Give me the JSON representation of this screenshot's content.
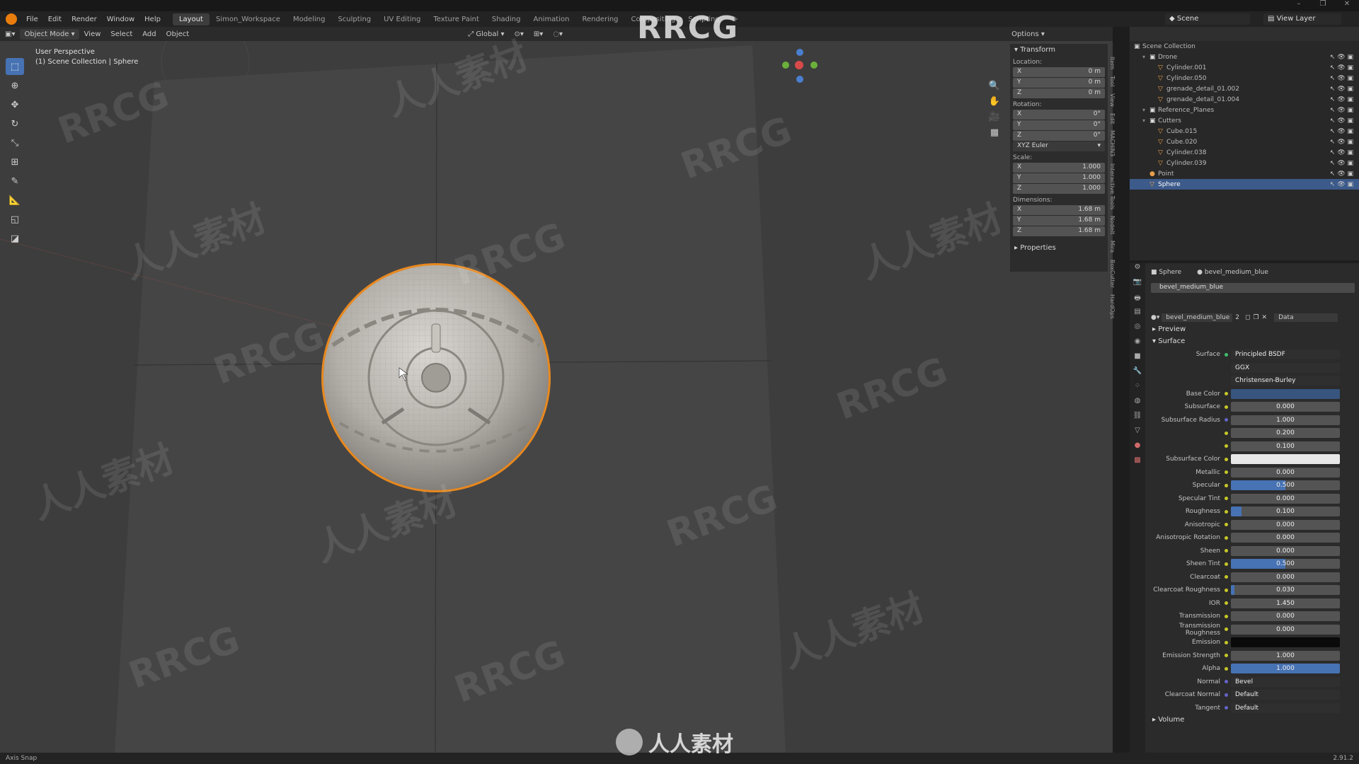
{
  "menu": [
    "File",
    "Edit",
    "Render",
    "Window",
    "Help"
  ],
  "workspaces": [
    "Layout",
    "Simon_Workspace",
    "Modeling",
    "Sculpting",
    "UV Editing",
    "Texture Paint",
    "Shading",
    "Animation",
    "Rendering",
    "Compositing",
    "Scripting",
    "+"
  ],
  "watermark_title": "RRCG",
  "watermark_cn": "人人素材",
  "scene": "Scene",
  "view_layer": "View Layer",
  "viewport_header": {
    "mode": "Object Mode",
    "items": [
      "View",
      "Select",
      "Add",
      "Object"
    ],
    "orientation": "Global",
    "options": "Options"
  },
  "viewport_info": {
    "line1": "User Perspective",
    "line2": "(1) Scene Collection | Sphere"
  },
  "npanel": {
    "transform": "Transform",
    "location_label": "Location:",
    "location": [
      {
        "a": "X",
        "v": "0 m"
      },
      {
        "a": "Y",
        "v": "0 m"
      },
      {
        "a": "Z",
        "v": "0 m"
      }
    ],
    "rotation_label": "Rotation:",
    "rotation": [
      {
        "a": "X",
        "v": "0°"
      },
      {
        "a": "Y",
        "v": "0°"
      },
      {
        "a": "Z",
        "v": "0°"
      }
    ],
    "rotation_mode": "XYZ Euler",
    "scale_label": "Scale:",
    "scale": [
      {
        "a": "X",
        "v": "1.000"
      },
      {
        "a": "Y",
        "v": "1.000"
      },
      {
        "a": "Z",
        "v": "1.000"
      }
    ],
    "dimensions_label": "Dimensions:",
    "dimensions": [
      {
        "a": "X",
        "v": "1.68 m"
      },
      {
        "a": "Y",
        "v": "1.68 m"
      },
      {
        "a": "Z",
        "v": "1.68 m"
      }
    ],
    "properties": "Properties",
    "tabs": [
      "Item",
      "Tool",
      "View",
      "Edit",
      "MACHIN3",
      "Interactive Tools",
      "NodeIt",
      "Mira",
      "BoxCutter",
      "HardOps"
    ]
  },
  "outliner": {
    "root": "Scene Collection",
    "rows": [
      {
        "name": "Drone",
        "level": 1,
        "kind": "collection"
      },
      {
        "name": "Cylinder.001",
        "level": 2,
        "kind": "mesh"
      },
      {
        "name": "Cylinder.050",
        "level": 2,
        "kind": "mesh"
      },
      {
        "name": "grenade_detail_01.002",
        "level": 2,
        "kind": "mesh"
      },
      {
        "name": "grenade_detail_01.004",
        "level": 2,
        "kind": "mesh"
      },
      {
        "name": "Reference_Planes",
        "level": 1,
        "kind": "collection"
      },
      {
        "name": "Cutters",
        "level": 1,
        "kind": "collection"
      },
      {
        "name": "Cube.015",
        "level": 2,
        "kind": "mesh"
      },
      {
        "name": "Cube.020",
        "level": 2,
        "kind": "mesh"
      },
      {
        "name": "Cylinder.038",
        "level": 2,
        "kind": "mesh"
      },
      {
        "name": "Cylinder.039",
        "level": 2,
        "kind": "mesh"
      },
      {
        "name": "Point",
        "level": 1,
        "kind": "light"
      },
      {
        "name": "Sphere",
        "level": 1,
        "kind": "mesh",
        "selected": true
      }
    ]
  },
  "properties": {
    "object": "Sphere",
    "material": "bevel_medium_blue",
    "slot": "bevel_medium_blue",
    "users": "2",
    "link": "Data",
    "preview": "Preview",
    "surface_section": "Surface",
    "surface": {
      "label": "Surface",
      "value": "Principled BSDF"
    },
    "distribution": "GGX",
    "subsurface_method": "Christensen-Burley",
    "rows": [
      {
        "label": "Base Color",
        "value": "",
        "type": "blue"
      },
      {
        "label": "Subsurface",
        "value": "0.000",
        "fill": 0
      },
      {
        "label": "Subsurface Radius",
        "value": "1.000",
        "type": "plainnum",
        "dot": "p"
      },
      {
        "label": "",
        "value": "0.200",
        "type": "plainnum"
      },
      {
        "label": "",
        "value": "0.100",
        "type": "plainnum"
      },
      {
        "label": "Subsurface Color",
        "value": "",
        "type": "white"
      },
      {
        "label": "Metallic",
        "value": "0.000",
        "fill": 0
      },
      {
        "label": "Specular",
        "value": "0.500",
        "fill": 0.5
      },
      {
        "label": "Specular Tint",
        "value": "0.000",
        "fill": 0
      },
      {
        "label": "Roughness",
        "value": "0.100",
        "fill": 0.1
      },
      {
        "label": "Anisotropic",
        "value": "0.000",
        "fill": 0
      },
      {
        "label": "Anisotropic Rotation",
        "value": "0.000",
        "fill": 0
      },
      {
        "label": "Sheen",
        "value": "0.000",
        "fill": 0
      },
      {
        "label": "Sheen Tint",
        "value": "0.500",
        "fill": 0.5
      },
      {
        "label": "Clearcoat",
        "value": "0.000",
        "fill": 0
      },
      {
        "label": "Clearcoat Roughness",
        "value": "0.030",
        "fill": 0.03
      },
      {
        "label": "IOR",
        "value": "1.450",
        "fill": 0
      },
      {
        "label": "Transmission",
        "value": "0.000",
        "fill": 0
      },
      {
        "label": "Transmission Roughness",
        "value": "0.000",
        "fill": 0
      },
      {
        "label": "Emission",
        "value": "",
        "type": "black"
      },
      {
        "label": "Emission Strength",
        "value": "1.000",
        "fill": 0
      },
      {
        "label": "Alpha",
        "value": "1.000",
        "fill": 1
      },
      {
        "label": "Normal",
        "value": "Bevel",
        "type": "plain",
        "dot": "p"
      },
      {
        "label": "Clearcoat Normal",
        "value": "Default",
        "type": "plain",
        "dot": "p"
      },
      {
        "label": "Tangent",
        "value": "Default",
        "type": "plain",
        "dot": "p"
      }
    ],
    "volume": "Volume"
  },
  "status": {
    "left": "Axis Snap",
    "version": "2.91.2"
  },
  "colors": {
    "accent": "#4772b3",
    "selection_outline": "#f0902a",
    "viewport_bg": "#3d3d3d"
  }
}
